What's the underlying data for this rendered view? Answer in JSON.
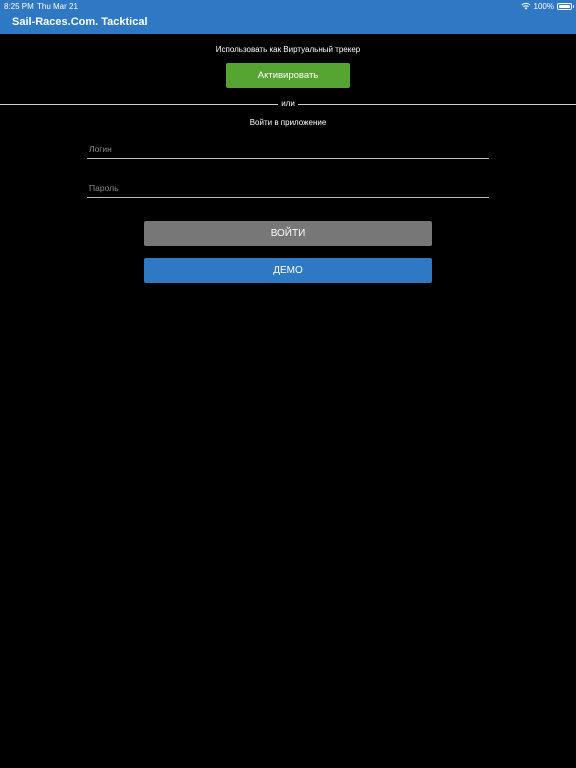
{
  "status_bar": {
    "time": "8:25 PM",
    "date": "Thu Mar 21",
    "battery_text": "100%",
    "battery_level": 1.0,
    "wifi_icon": "wifi-icon",
    "battery_icon": "battery-icon"
  },
  "app": {
    "title": "Sail-Races.Com. Tacktical"
  },
  "tracker": {
    "label": "Использовать как Виртуальный трекер",
    "activate_label": "Активировать"
  },
  "divider": {
    "text": "или"
  },
  "login": {
    "label": "Войти в приложение",
    "login_placeholder": "Логин",
    "login_value": "",
    "password_placeholder": "Пароль",
    "password_value": "",
    "enter_label": "ВОЙТИ",
    "demo_label": "ДЕМО"
  },
  "colors": {
    "header": "#2F78C4",
    "activate": "#56A532",
    "enter": "#777777",
    "demo": "#2F78C4",
    "background": "#000000"
  }
}
